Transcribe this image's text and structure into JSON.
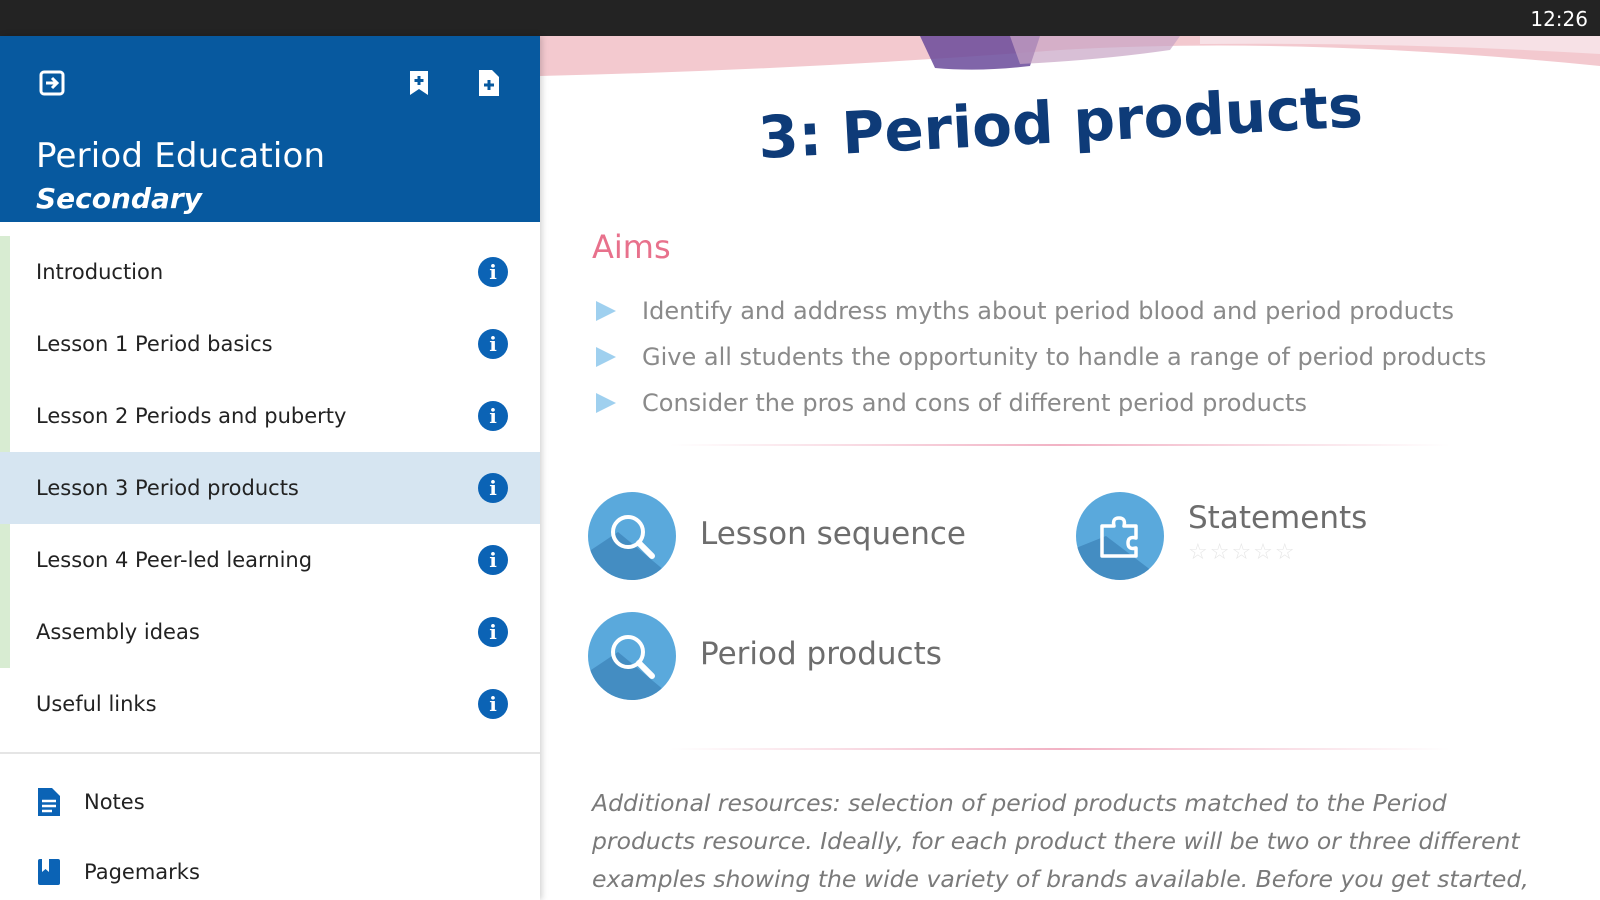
{
  "status_bar": {
    "time": "12:26"
  },
  "sidebar": {
    "title": "Period Education",
    "subtitle": "Secondary",
    "header_icons": [
      "exit-icon",
      "bookmark-add-icon",
      "note-add-icon"
    ],
    "items": [
      {
        "label": "Introduction"
      },
      {
        "label": "Lesson 1 Period basics"
      },
      {
        "label": "Lesson 2 Periods and puberty"
      },
      {
        "label": "Lesson 3 Period products",
        "active": true
      },
      {
        "label": "Lesson 4 Peer-led learning"
      },
      {
        "label": "Assembly ideas"
      },
      {
        "label": "Useful links"
      }
    ],
    "bottom_items": [
      {
        "label": "Notes",
        "icon": "document-icon"
      },
      {
        "label": "Pagemarks",
        "icon": "bookmark-icon"
      }
    ],
    "colors": {
      "header": "#07599f",
      "active_row": "#d6e5f1",
      "info": "#0b63b5"
    }
  },
  "content": {
    "title": "3: Period products",
    "aims_heading": "Aims",
    "aims": [
      "Identify and address myths about period blood and period products",
      "Give all students the opportunity to handle a range of period products",
      "Consider the pros and cons of different period products"
    ],
    "resources": [
      {
        "label": "Lesson sequence",
        "icon": "magnifier-icon"
      },
      {
        "label": "Statements",
        "icon": "puzzle-icon",
        "rating": 0,
        "rating_max": 5
      },
      {
        "label": "Period products",
        "icon": "magnifier-icon"
      }
    ],
    "additional": "Additional resources: selection of period products matched to the Period products resource. Ideally, for each product there will be two or three different examples showing the wide variety of brands available. Before you get started,",
    "colors": {
      "title": "#0e3b78",
      "aims": "#e8718c",
      "resource_circle": "#5aa9dc"
    }
  }
}
